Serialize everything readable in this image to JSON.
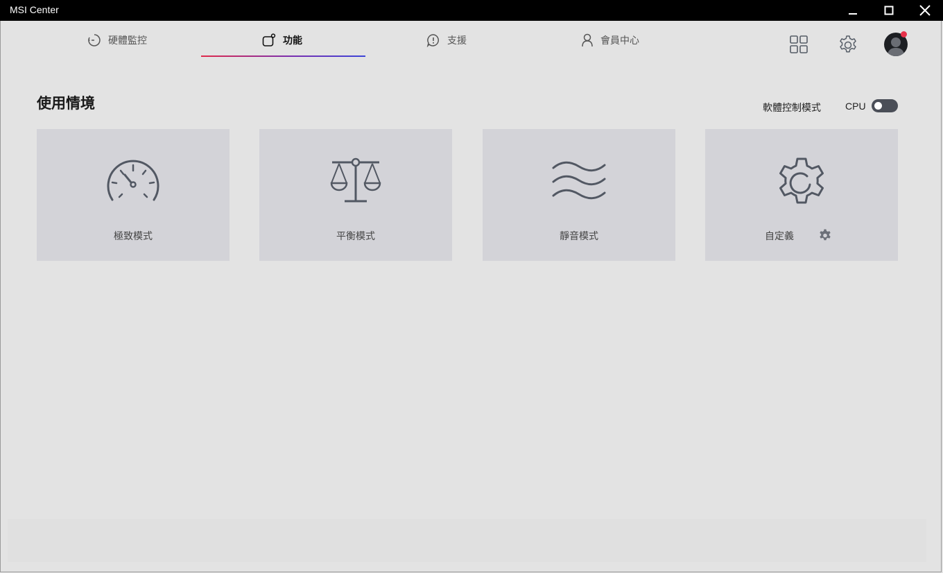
{
  "window": {
    "title": "MSI Center"
  },
  "tabs": [
    {
      "label": "硬體監控",
      "icon": "clock-dash-icon",
      "active": false
    },
    {
      "label": "功能",
      "icon": "feature-square-icon",
      "active": true
    },
    {
      "label": "支援",
      "icon": "alert-bubble-icon",
      "active": false
    },
    {
      "label": "會員中心",
      "icon": "user-icon",
      "active": false
    }
  ],
  "toolbar": {
    "apps_icon": "grid-icon",
    "settings_icon": "gear-icon",
    "avatar_icon": "avatar-icon"
  },
  "main": {
    "section_title": "使用情境",
    "control_mode_label": "軟體控制模式",
    "cpu_label": "CPU",
    "cpu_toggle_on": false
  },
  "cards": [
    {
      "label": "極致模式",
      "icon": "speedometer-icon"
    },
    {
      "label": "平衡模式",
      "icon": "balance-scale-icon"
    },
    {
      "label": "靜音模式",
      "icon": "waves-icon"
    },
    {
      "label": "自定義",
      "icon": "gear-icon"
    }
  ],
  "colors": {
    "accent_start": "#e0294a",
    "accent_end": "#3b44d8",
    "card_bg": "#d3d3d8",
    "icon_stroke": "#525863"
  }
}
